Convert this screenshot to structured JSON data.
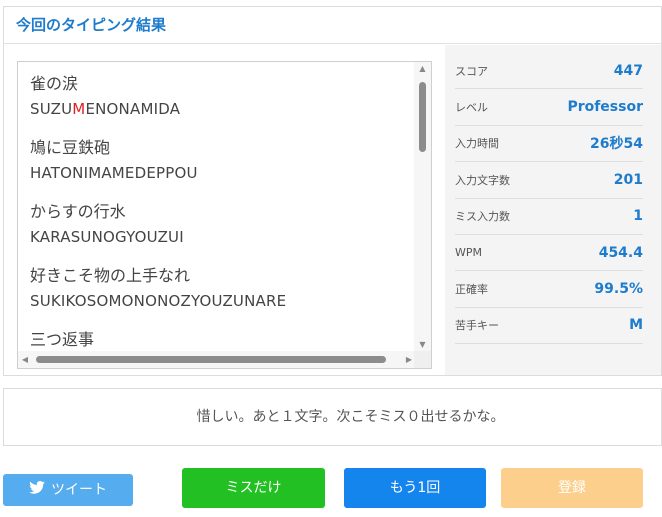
{
  "panel": {
    "title": "今回のタイピング結果"
  },
  "words": [
    {
      "kanji": "雀の涙",
      "roma_pre": "SUZU",
      "roma_miss": "M",
      "roma_post": "ENONAMIDA"
    },
    {
      "kanji": "鳩に豆鉄砲",
      "roma_pre": "HATONIMAMEDEPPOU",
      "roma_miss": "",
      "roma_post": ""
    },
    {
      "kanji": "からすの行水",
      "roma_pre": "KARASUNOGYOUZUI",
      "roma_miss": "",
      "roma_post": ""
    },
    {
      "kanji": "好きこそ物の上手なれ",
      "roma_pre": "SUKIKOSOMONONOZYOUZUNARE",
      "roma_miss": "",
      "roma_post": ""
    },
    {
      "kanji": "三つ返事",
      "roma_pre": "",
      "roma_miss": "",
      "roma_post": ""
    }
  ],
  "stats": [
    {
      "label": "スコア",
      "value": "447"
    },
    {
      "label": "レベル",
      "value": "Professor"
    },
    {
      "label": "入力時間",
      "value": "26秒54"
    },
    {
      "label": "入力文字数",
      "value": "201"
    },
    {
      "label": "ミス入力数",
      "value": "1"
    },
    {
      "label": "WPM",
      "value": "454.4"
    },
    {
      "label": "正確率",
      "value": "99.5%"
    },
    {
      "label": "苦手キー",
      "value": "M"
    }
  ],
  "message": "惜しい。あと１文字。次こそミス０出せるかな。",
  "buttons": {
    "tweet": "ツイート",
    "miss_only": "ミスだけ",
    "retry": "もう1回",
    "register": "登録"
  },
  "colors": {
    "accent": "#1e7ccc",
    "miss": "#e02020",
    "tweet": "#55acee",
    "miss_only": "#22c022",
    "retry": "#1585ee",
    "register": "#fcd08c"
  },
  "icons": {
    "tweet": "twitter-bird-icon"
  }
}
